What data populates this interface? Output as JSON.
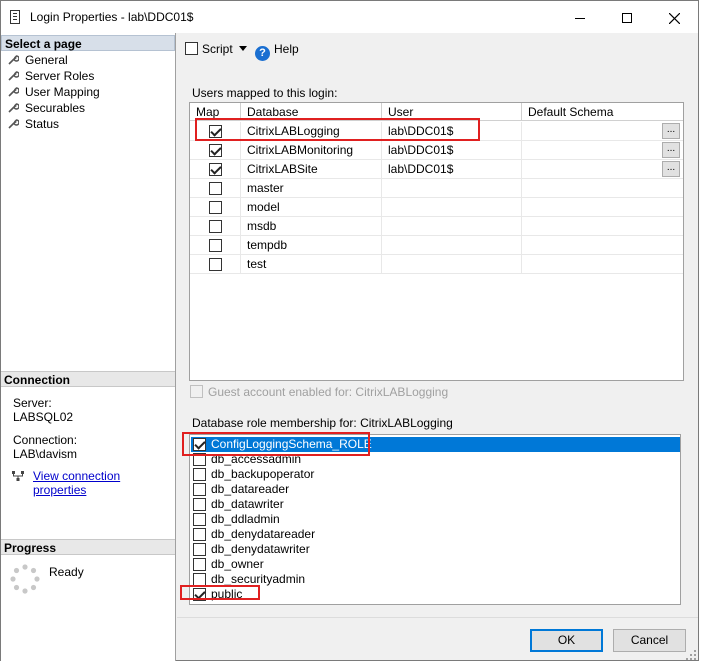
{
  "window": {
    "title": "Login Properties - lab\\DDC01$"
  },
  "left": {
    "select_page_header": "Select a page",
    "nav_items": [
      {
        "label": "General"
      },
      {
        "label": "Server Roles"
      },
      {
        "label": "User Mapping"
      },
      {
        "label": "Securables"
      },
      {
        "label": "Status"
      }
    ],
    "connection_header": "Connection",
    "server_label": "Server:",
    "server_value": "LABSQL02",
    "connection_label": "Connection:",
    "connection_value": "LAB\\davism",
    "view_connection_link": "View connection properties",
    "progress_header": "Progress",
    "progress_status": "Ready"
  },
  "toolbar": {
    "script_label": "Script",
    "help_label": "Help"
  },
  "users_mapped": {
    "label": "Users mapped to this login:",
    "columns": [
      "Map",
      "Database",
      "User",
      "Default Schema"
    ],
    "rows": [
      {
        "checked": true,
        "database": "CitrixLABLogging",
        "user": "lab\\DDC01$",
        "schema": "",
        "has_button": true
      },
      {
        "checked": true,
        "database": "CitrixLABMonitoring",
        "user": "lab\\DDC01$",
        "schema": "",
        "has_button": true
      },
      {
        "checked": true,
        "database": "CitrixLABSite",
        "user": "lab\\DDC01$",
        "schema": "",
        "has_button": true
      },
      {
        "checked": false,
        "database": "master",
        "user": "",
        "schema": "",
        "has_button": false
      },
      {
        "checked": false,
        "database": "model",
        "user": "",
        "schema": "",
        "has_button": false
      },
      {
        "checked": false,
        "database": "msdb",
        "user": "",
        "schema": "",
        "has_button": false
      },
      {
        "checked": false,
        "database": "tempdb",
        "user": "",
        "schema": "",
        "has_button": false
      },
      {
        "checked": false,
        "database": "test",
        "user": "",
        "schema": "",
        "has_button": false
      }
    ],
    "ellipsis": "..."
  },
  "guest": {
    "label": "Guest account enabled for: CitrixLABLogging",
    "checked": false
  },
  "role_membership": {
    "label": "Database role membership for: CitrixLABLogging",
    "roles": [
      {
        "name": "ConfigLoggingSchema_ROLE",
        "checked": true,
        "selected": true
      },
      {
        "name": "db_accessadmin",
        "checked": false,
        "selected": false
      },
      {
        "name": "db_backupoperator",
        "checked": false,
        "selected": false
      },
      {
        "name": "db_datareader",
        "checked": false,
        "selected": false
      },
      {
        "name": "db_datawriter",
        "checked": false,
        "selected": false
      },
      {
        "name": "db_ddladmin",
        "checked": false,
        "selected": false
      },
      {
        "name": "db_denydatareader",
        "checked": false,
        "selected": false
      },
      {
        "name": "db_denydatawriter",
        "checked": false,
        "selected": false
      },
      {
        "name": "db_owner",
        "checked": false,
        "selected": false
      },
      {
        "name": "db_securityadmin",
        "checked": false,
        "selected": false
      },
      {
        "name": "public",
        "checked": true,
        "selected": false
      }
    ]
  },
  "buttons": {
    "ok": "OK",
    "cancel": "Cancel"
  },
  "colors": {
    "highlight": "#e02020",
    "selection": "#0078d7",
    "link": "#0000cc"
  }
}
